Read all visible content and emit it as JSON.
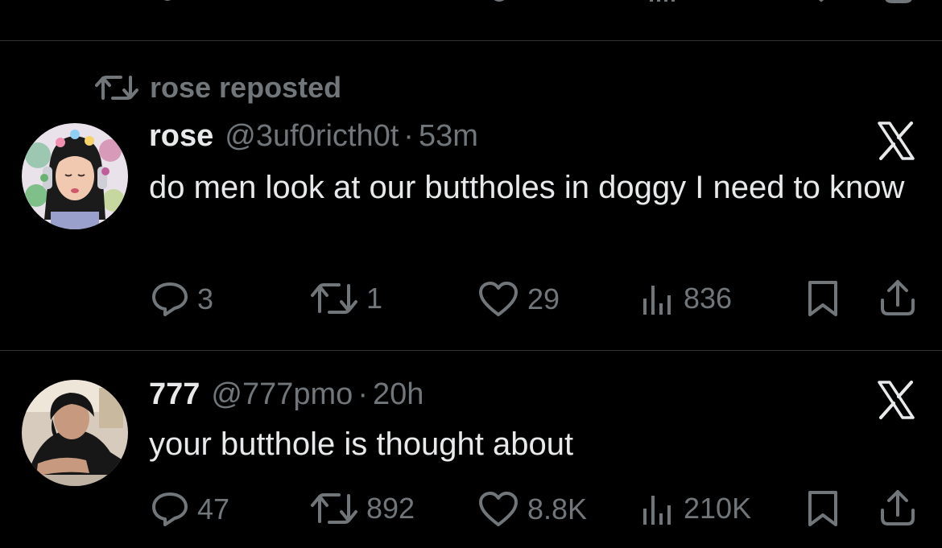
{
  "tweets": [
    {
      "repost_label": "rose reposted",
      "name": "rose",
      "handle": "@3uf0ricth0t",
      "separator": "·",
      "time": "53m",
      "text": "do men look at our buttholes in doggy I need to know",
      "replies": "3",
      "reposts": "1",
      "likes": "29",
      "views": "836"
    },
    {
      "name": "777",
      "handle": "@777pmo",
      "separator": "·",
      "time": "20h",
      "text": "your butthole is thought about",
      "replies": "47",
      "reposts": "892",
      "likes": "8.8K",
      "views": "210K"
    }
  ],
  "colors": {
    "background": "#000000",
    "text_primary": "#e7e9ea",
    "text_secondary": "#71767b",
    "divider": "#2f3336"
  },
  "icons": [
    "repost-icon",
    "reply-icon",
    "like-icon",
    "views-icon",
    "bookmark-icon",
    "share-icon",
    "x-logo-icon"
  ]
}
